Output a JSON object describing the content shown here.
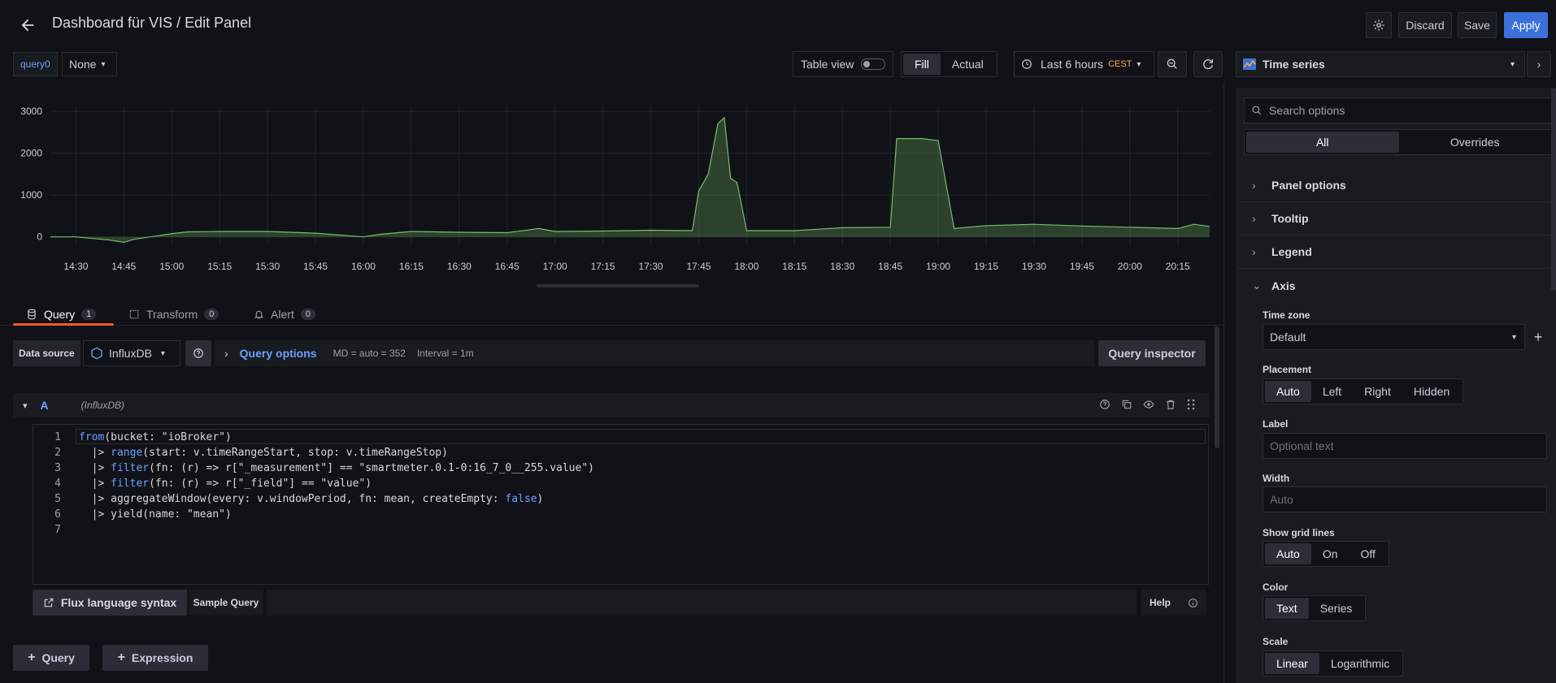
{
  "header": {
    "title": "Dashboard für VIS / Edit Panel",
    "discard_label": "Discard",
    "save_label": "Save",
    "apply_label": "Apply"
  },
  "toolbar": {
    "query_var_label": "query0",
    "query_var_value": "None",
    "table_view_label": "Table view",
    "fill_label": "Fill",
    "actual_label": "Actual",
    "time_range_label": "Last 6 hours",
    "timezone_badge": "CEST",
    "viz_label": "Time series"
  },
  "chart_data": {
    "type": "area",
    "x": [
      "14:22",
      "14:30",
      "14:37",
      "14:40",
      "14:45",
      "14:48",
      "14:55",
      "15:00",
      "15:05",
      "15:15",
      "15:30",
      "15:45",
      "15:50",
      "16:00",
      "16:05",
      "16:15",
      "16:30",
      "16:45",
      "16:55",
      "17:00",
      "17:15",
      "17:30",
      "17:43",
      "17:45",
      "17:48",
      "17:51",
      "17:53",
      "17:55",
      "17:57",
      "18:00",
      "18:15",
      "18:30",
      "18:45",
      "18:47",
      "18:55",
      "19:00",
      "19:05",
      "19:15",
      "19:30",
      "19:45",
      "20:00",
      "20:15",
      "20:20",
      "20:25"
    ],
    "values": [
      0,
      0,
      -50,
      -70,
      -130,
      -60,
      20,
      80,
      120,
      130,
      130,
      90,
      60,
      0,
      60,
      130,
      110,
      100,
      200,
      130,
      140,
      160,
      150,
      1100,
      1500,
      2700,
      2850,
      1400,
      1300,
      150,
      150,
      220,
      230,
      2350,
      2350,
      2300,
      200,
      270,
      300,
      260,
      230,
      200,
      300,
      250
    ],
    "ylim": [
      -200,
      3100
    ],
    "yticks": [
      0,
      1000,
      2000,
      3000
    ],
    "xticks": [
      "14:30",
      "14:45",
      "15:00",
      "15:15",
      "15:30",
      "15:45",
      "16:00",
      "16:15",
      "16:30",
      "16:45",
      "17:00",
      "17:15",
      "17:30",
      "17:45",
      "18:00",
      "18:15",
      "18:30",
      "18:45",
      "19:00",
      "19:15",
      "19:30",
      "19:45",
      "20:00",
      "20:15"
    ],
    "grid": true,
    "series_color": "#73bf69"
  },
  "tabs": [
    {
      "label": "Query",
      "count": "1"
    },
    {
      "label": "Transform",
      "count": "0"
    },
    {
      "label": "Alert",
      "count": "0"
    }
  ],
  "datasource": {
    "label": "Data source",
    "value": "InfluxDB",
    "query_options_label": "Query options",
    "md_info": "MD = auto = 352",
    "interval_info": "Interval = 1m",
    "inspector_label": "Query inspector"
  },
  "query_row": {
    "ref_id": "A",
    "ds_name": "(InfluxDB)"
  },
  "code_lines": [
    "from(bucket: \"ioBroker\")",
    "  |> range(start: v.timeRangeStart, stop: v.timeRangeStop)",
    "  |> filter(fn: (r) => r[\"_measurement\"] == \"smartmeter.0.1-0:16_7_0__255.value\")",
    "  |> filter(fn: (r) => r[\"_field\"] == \"value\")",
    "  |> aggregateWindow(every: v.windowPeriod, fn: mean, createEmpty: false)",
    "  |> yield(name: \"mean\")",
    ""
  ],
  "editor_footer": {
    "flux_label": "Flux language syntax",
    "sample_query_label": "Sample Query",
    "help_label": "Help"
  },
  "add_buttons": {
    "query_label": "Query",
    "expression_label": "Expression"
  },
  "options": {
    "search_placeholder": "Search options",
    "all_label": "All",
    "overrides_label": "Overrides",
    "sections": [
      "Panel options",
      "Tooltip",
      "Legend",
      "Axis"
    ],
    "time_zone_label": "Time zone",
    "time_zone_value": "Default",
    "placement_label": "Placement",
    "placement_options": [
      "Auto",
      "Left",
      "Right",
      "Hidden"
    ],
    "label_label": "Label",
    "label_placeholder": "Optional text",
    "width_label": "Width",
    "width_placeholder": "Auto",
    "grid_label": "Show grid lines",
    "grid_options": [
      "Auto",
      "On",
      "Off"
    ],
    "color_label": "Color",
    "color_options": [
      "Text",
      "Series"
    ],
    "scale_label": "Scale",
    "scale_options": [
      "Linear",
      "Logarithmic"
    ]
  },
  "colors": {
    "accent": "#3d71d9",
    "tab_underline": "#f05a28",
    "cest": "#f5a742",
    "link": "#6e9fff"
  }
}
